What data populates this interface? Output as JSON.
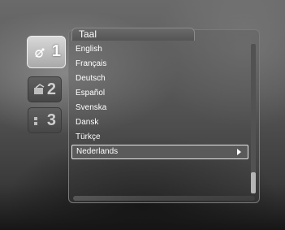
{
  "menu": {
    "title": "Taal",
    "tabs": [
      {
        "number": "1",
        "icon": "satellite-icon",
        "active": true
      },
      {
        "number": "2",
        "icon": "settings-icon",
        "active": false
      },
      {
        "number": "3",
        "icon": "tools-icon",
        "active": false
      }
    ],
    "languages": [
      {
        "label": "English"
      },
      {
        "label": "Français"
      },
      {
        "label": "Deutsch"
      },
      {
        "label": "Español"
      },
      {
        "label": "Svenska"
      },
      {
        "label": "Dansk"
      },
      {
        "label": "Türkçe"
      },
      {
        "label": "Nederlands",
        "selected": true
      }
    ],
    "scroll_position": 0.86
  }
}
